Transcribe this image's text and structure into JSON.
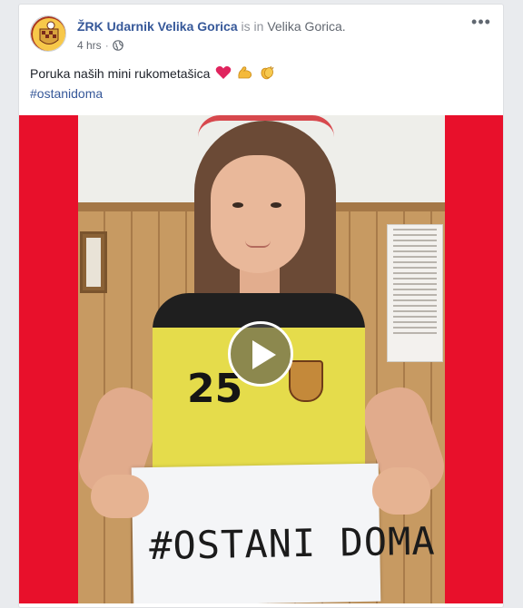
{
  "post": {
    "page_name": "ŽRK Udarnik Velika Gorica",
    "checkin_text": "is in",
    "location": "Velika Gorica.",
    "time": "4 hrs",
    "separator": "·",
    "privacy_icon": "globe-icon",
    "more_label": "•••",
    "caption_text": "Poruka naših mini rukometašica",
    "caption_emojis": [
      "heart-emoji",
      "flexed-biceps-emoji",
      "clapping-hands-emoji"
    ],
    "hashtag": "#ostanidoma"
  },
  "media": {
    "type": "video",
    "play_icon": "play-icon",
    "jersey_number": "25",
    "sign_text": "#OSTANI DOMA"
  },
  "colors": {
    "link": "#365899",
    "video_bg": "#e8102b",
    "card_border": "#dddfe2"
  }
}
